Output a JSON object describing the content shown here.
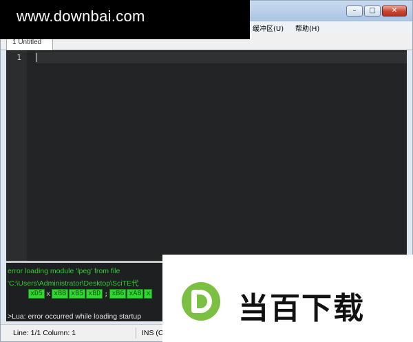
{
  "window": {
    "controls": {
      "minimize": "–",
      "maximize": "□",
      "close": "✕"
    }
  },
  "menu": {
    "buffers": "缓冲区(U)",
    "help": "帮助(H)"
  },
  "tab": {
    "label": "1 Untitled"
  },
  "editor": {
    "line_number": "1"
  },
  "output": {
    "line1": "error loading module 'lpeg' from file",
    "line2": "'C:\\Users\\Administrator\\Desktop\\SciTE代",
    "hex_chips": [
      "xD5",
      "x",
      "xBB",
      "xB5",
      "xBD",
      ";",
      "xB6",
      "xA8",
      "x"
    ],
    "line4": ">Lua: error occurred while loading startup"
  },
  "statusbar": {
    "position": "Line: 1/1  Column: 1",
    "mode": "INS (C"
  },
  "watermark": {
    "top_text": "www.downbai.com",
    "brand_text": "当百下载"
  },
  "colors": {
    "editor_bg": "#232425",
    "output_green": "#37c737",
    "brand_green": "#7cc043"
  }
}
